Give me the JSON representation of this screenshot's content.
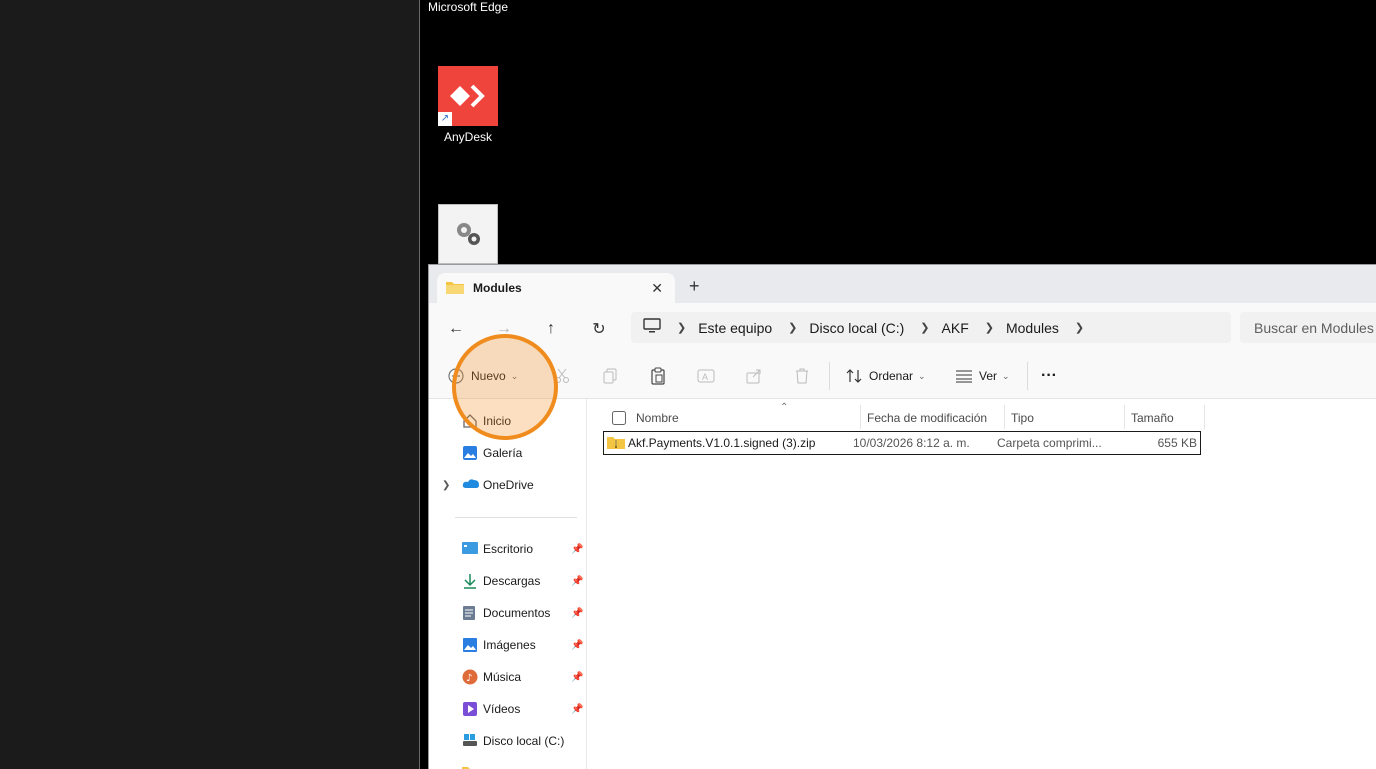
{
  "desktop": {
    "top_label": "Microsoft Edge",
    "icons": [
      {
        "label": "AnyDesk",
        "icon": "anydesk-icon"
      },
      {
        "label": "",
        "icon": "settings-gears-icon"
      }
    ]
  },
  "explorer": {
    "tab": {
      "title": "Modules",
      "icon": "folder-icon"
    },
    "nav": {
      "back": "←",
      "forward": "→",
      "up": "↑",
      "refresh": "↻"
    },
    "breadcrumb": [
      "Este equipo",
      "Disco local (C:)",
      "AKF",
      "Modules"
    ],
    "search_placeholder": "Buscar en Modules",
    "toolbar": {
      "new_label": "Nuevo",
      "sort_label": "Ordenar",
      "view_label": "Ver",
      "more_label": "···"
    },
    "sidebar": {
      "top_items": [
        {
          "label": "Inicio",
          "icon": "home-icon"
        },
        {
          "label": "Galería",
          "icon": "gallery-icon"
        },
        {
          "label": "OneDrive",
          "icon": "onedrive-icon"
        }
      ],
      "pinned_items": [
        {
          "label": "Escritorio",
          "icon": "desktop-icon"
        },
        {
          "label": "Descargas",
          "icon": "downloads-icon"
        },
        {
          "label": "Documentos",
          "icon": "documents-icon"
        },
        {
          "label": "Imágenes",
          "icon": "pictures-icon"
        },
        {
          "label": "Música",
          "icon": "music-icon"
        },
        {
          "label": "Vídeos",
          "icon": "videos-icon"
        }
      ],
      "drive_item": {
        "label": "Disco local (C:)",
        "icon": "drive-icon"
      }
    },
    "columns": [
      "Nombre",
      "Fecha de modificación",
      "Tipo",
      "Tamaño"
    ],
    "files": [
      {
        "name": "Akf.Payments.V1.0.1.signed (3).zip",
        "modified": "10/03/2026 8:12 a. m.",
        "type": "Carpeta comprimi...",
        "size": "655 KB"
      }
    ]
  },
  "colors": {
    "accent_halo": "#f08c1e",
    "anydesk_red": "#ef443b",
    "folder_yellow": "#f4c542"
  }
}
